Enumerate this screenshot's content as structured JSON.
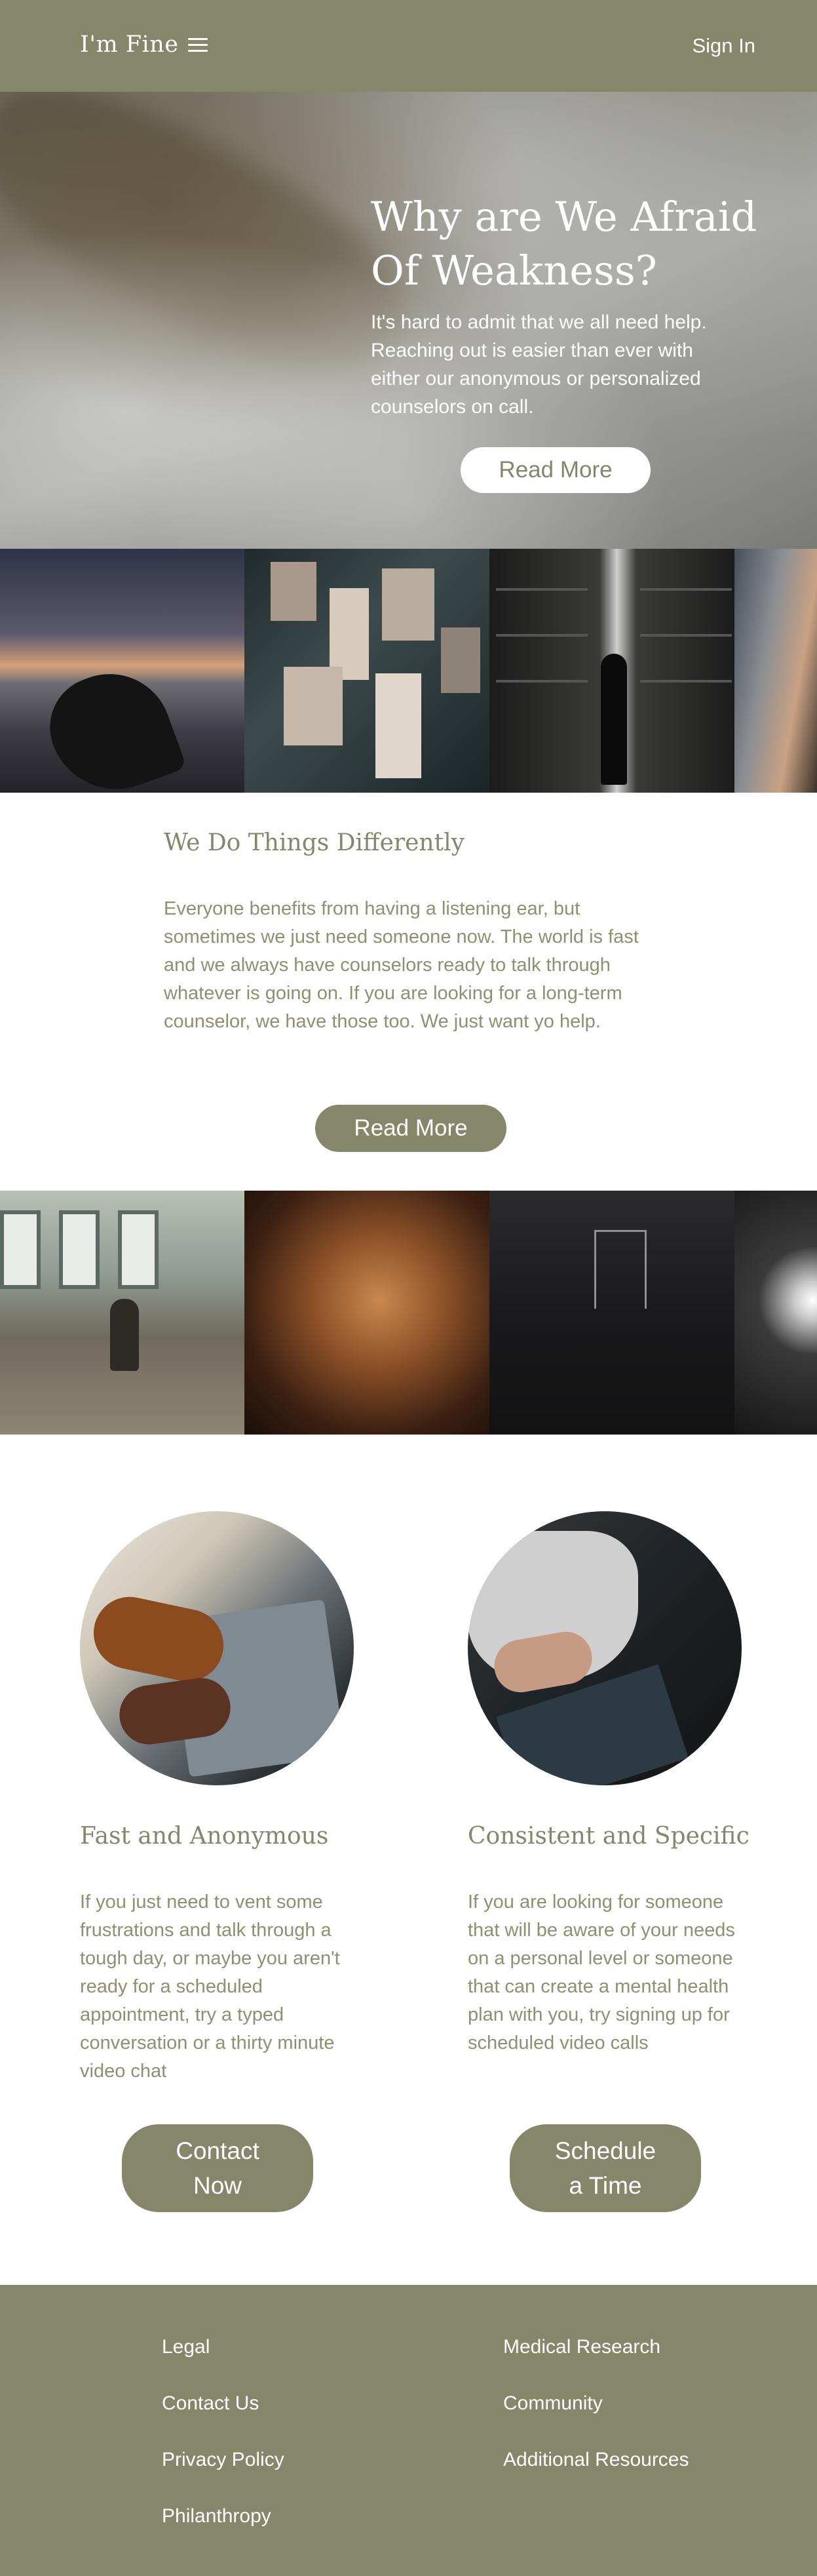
{
  "header": {
    "logo": "I'm Fine",
    "menu_icon": "hamburger-menu-icon",
    "sign_in": "Sign In"
  },
  "hero": {
    "title": "Why are We Afraid Of Weakness?",
    "text": "It's hard to admit that we all need help. Reaching out is easier than ever with either our anonymous or personalized counselors on call.",
    "button": "Read More"
  },
  "about": {
    "title": "We Do Things Differently",
    "text": "Everyone benefits from having a listening ear, but sometimes we just need someone now. The world is fast and we always have counselors ready to talk through whatever is going on. If you are looking for a long-term counselor, we have those too. We just want yo help.",
    "button": "Read More"
  },
  "options": [
    {
      "title": "Fast and Anonymous",
      "text": "If you just need to vent some frustrations and talk through a tough day,  or maybe you aren't ready for a scheduled appointment, try a typed conversation or a thirty minute video chat",
      "button_line1": "Contact",
      "button_line2": "Now"
    },
    {
      "title": "Consistent and Specific",
      "text": "If you are looking for someone that will be aware of your needs on a personal level or someone that can create a mental health plan with you, try signing up for scheduled video calls",
      "button_line1": "Schedule",
      "button_line2": "a Time"
    }
  ],
  "footer": {
    "left": [
      "Legal",
      "Contact Us",
      "Privacy Policy",
      "Philanthropy"
    ],
    "right": [
      "Medical Research",
      "Community",
      "Additional Resources"
    ]
  },
  "colors": {
    "brand_olive": "#86876a",
    "text_olive": "#8f9070",
    "white": "#ffffff"
  }
}
